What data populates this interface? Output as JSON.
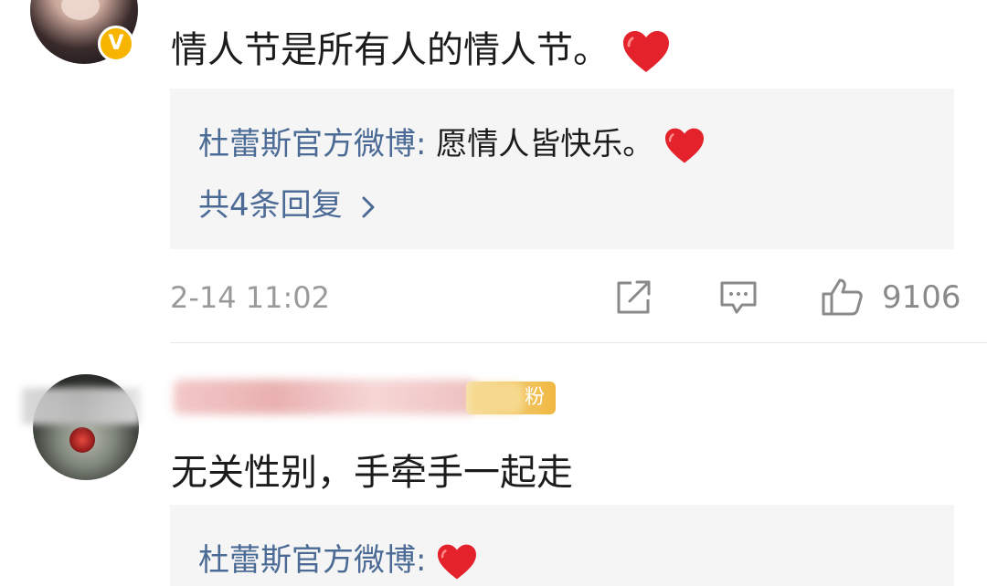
{
  "comments": [
    {
      "text": "情人节是所有人的情人节。",
      "verified_badge": "V",
      "reply": {
        "author": "杜蕾斯官方微博",
        "separator": ": ",
        "text": "愿情人皆快乐。"
      },
      "reply_count": "共4条回复",
      "time": "2-14 11:02",
      "like_count": "9106"
    },
    {
      "text": "无关性别，手牵手一起走",
      "fan_badge": "粉",
      "reply": {
        "author": "杜蕾斯官方微博",
        "separator": ": "
      }
    }
  ],
  "icons": {
    "heart": "red-heart-emoji",
    "share": "share-icon",
    "comment": "comment-icon",
    "like": "thumbs-up-icon",
    "chevron": "chevron-right-icon"
  },
  "colors": {
    "link_blue": "#4b6a95",
    "reply_bg": "#f5f5f5",
    "meta_gray": "#9a9a9a",
    "heart_red": "#e3222b",
    "verified_gold": "#f7b500"
  }
}
